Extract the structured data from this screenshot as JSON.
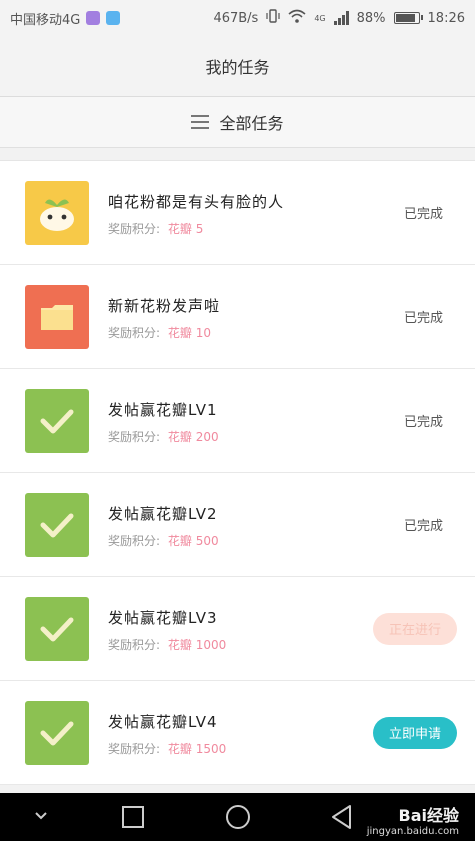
{
  "status_bar": {
    "carrier": "中国移动4G",
    "speed": "467B/s",
    "network": "4G",
    "battery": "88%",
    "time": "18:26"
  },
  "header": {
    "title": "我的任务"
  },
  "filter": {
    "label": "全部任务"
  },
  "tasks": [
    {
      "title": "咱花粉都是有头有脸的人",
      "reward_label": "奖励积分:",
      "reward_value": "花瓣 5",
      "status": "已完成"
    },
    {
      "title": "新新花粉发声啦",
      "reward_label": "奖励积分:",
      "reward_value": "花瓣 10",
      "status": "已完成"
    },
    {
      "title": "发帖赢花瓣LV1",
      "reward_label": "奖励积分:",
      "reward_value": "花瓣 200",
      "status": "已完成"
    },
    {
      "title": "发帖赢花瓣LV2",
      "reward_label": "奖励积分:",
      "reward_value": "花瓣 500",
      "status": "已完成"
    },
    {
      "title": "发帖赢花瓣LV3",
      "reward_label": "奖励积分:",
      "reward_value": "花瓣 1000",
      "status": "正在进行"
    },
    {
      "title": "发帖赢花瓣LV4",
      "reward_label": "奖励积分:",
      "reward_value": "花瓣 1500",
      "status": "立即申请"
    }
  ],
  "watermark": {
    "brand": "Bai经验",
    "url": "jingyan.baidu.com"
  },
  "colors": {
    "accent": "#29bfc8",
    "in_progress": "#fde0d8",
    "check_green": "#8cc152",
    "yellow_icon": "#f7c948",
    "orange_icon": "#ef6f52",
    "points_pink": "#f08a9e"
  }
}
